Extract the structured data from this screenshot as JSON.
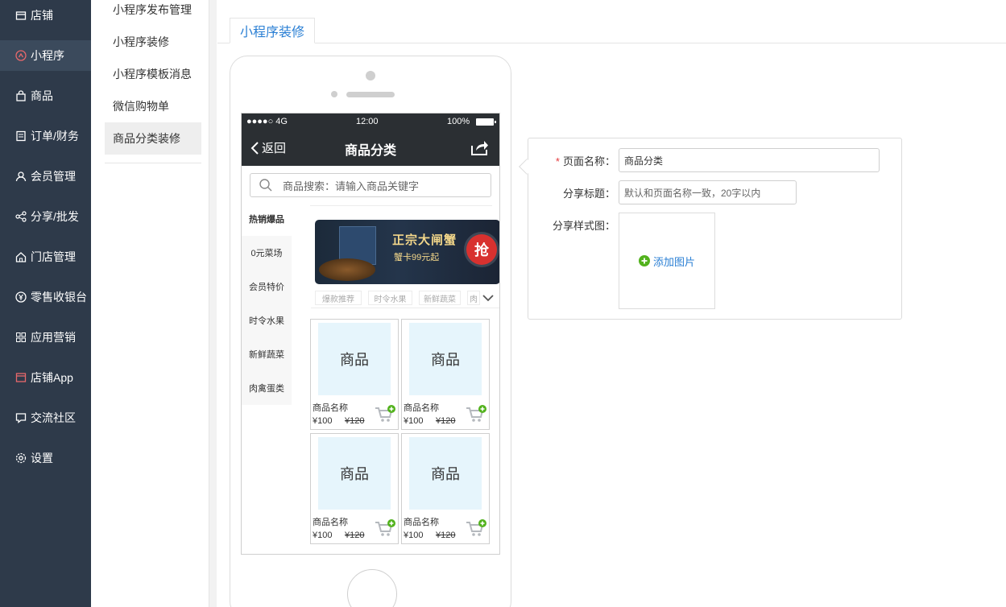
{
  "nav_main": [
    {
      "label": "店铺",
      "icon": "store-icon"
    },
    {
      "label": "小程序",
      "icon": "mini-program-icon",
      "active": true
    },
    {
      "label": "商品",
      "icon": "bag-icon"
    },
    {
      "label": "订单/财务",
      "icon": "order-icon"
    },
    {
      "label": "会员管理",
      "icon": "member-icon"
    },
    {
      "label": "分享/批发",
      "icon": "share-icon"
    },
    {
      "label": "门店管理",
      "icon": "home-store-icon"
    },
    {
      "label": "零售收银台",
      "icon": "cashier-icon"
    },
    {
      "label": "应用营销",
      "icon": "apps-icon"
    },
    {
      "label": "店铺App",
      "icon": "app-icon"
    },
    {
      "label": "交流社区",
      "icon": "chat-icon"
    },
    {
      "label": "设置",
      "icon": "gear-icon"
    }
  ],
  "nav_sub": [
    {
      "label": "小程序发布管理"
    },
    {
      "label": "小程序装修"
    },
    {
      "label": "小程序模板消息"
    },
    {
      "label": "微信购物单"
    },
    {
      "label": "商品分类装修",
      "active": true
    }
  ],
  "tab": {
    "label": "小程序装修"
  },
  "phone": {
    "status": {
      "signal": "●●●●○ 4G",
      "time": "12:00",
      "battery": "100%"
    },
    "back_label": "返回",
    "title": "商品分类",
    "search_placeholder": "商品搜索：请输入商品关键字",
    "categories": [
      "热销爆品",
      "0元菜场",
      "会员特价",
      "时令水果",
      "新鲜蔬菜",
      "肉禽蛋类"
    ],
    "banner": {
      "line1": "正宗大闸蟹",
      "line2": "蟹卡99元起",
      "badge": "抢"
    },
    "subtabs": [
      "爆款推荐",
      "时令水果",
      "新鲜蔬菜",
      "肉"
    ],
    "products": [
      {
        "image_label": "商品",
        "name": "商品名称",
        "price": "¥100",
        "old_price": "¥120"
      },
      {
        "image_label": "商品",
        "name": "商品名称",
        "price": "¥100",
        "old_price": "¥120"
      },
      {
        "image_label": "商品",
        "name": "商品名称",
        "price": "¥100",
        "old_price": "¥120"
      },
      {
        "image_label": "商品",
        "name": "商品名称",
        "price": "¥100",
        "old_price": "¥120"
      }
    ]
  },
  "form": {
    "page_name_label": "页面名称：",
    "page_name_required": "*",
    "page_name_value": "商品分类",
    "share_title_label": "分享标题：",
    "share_title_placeholder": "默认和页面名称一致，20字以内",
    "share_image_label": "分享样式图：",
    "add_image_label": "添加图片"
  },
  "colors": {
    "sidebar_bg": "#2e3a4a",
    "accent": "#2a7fd4",
    "required": "#e4393c",
    "add_green": "#52b21d"
  }
}
